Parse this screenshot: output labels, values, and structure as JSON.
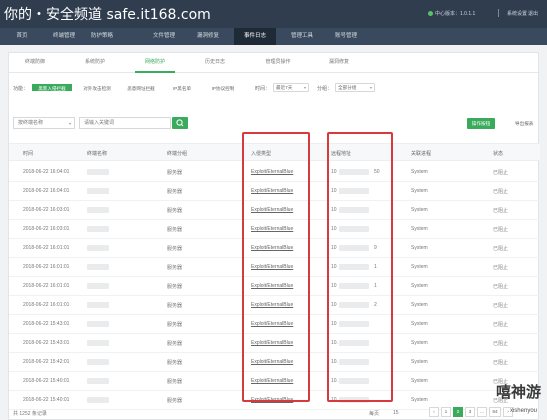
{
  "header": {
    "watermark_title": "你的・安全频道 safe.it168.com",
    "center_version": "中心版本：1.0.1.1",
    "links": [
      "系统设置",
      "退出"
    ]
  },
  "nav": {
    "items": [
      "首页",
      "终端管理",
      "防护策略",
      "文件管理",
      "漏洞修复",
      "事件日志",
      "管理工具",
      "账号管理"
    ],
    "active": "事件日志"
  },
  "subtabs": {
    "items": [
      "终端防御",
      "系统防护",
      "网络防护",
      "历史日志",
      "管理员操作",
      "漏洞修复"
    ],
    "active": "网络防护"
  },
  "filters": {
    "function_label": "功能：",
    "function_options": [
      "黑客入侵拦截",
      "对外攻击检测",
      "恶意网址拦截",
      "IP黑名单",
      "IP协议控制"
    ],
    "function_active": "黑客入侵拦截",
    "time_label": "时间：",
    "time_value": "最近7天",
    "group_label": "分组：",
    "group_value": "全部分组"
  },
  "search": {
    "select_value": "按终端名称",
    "placeholder": "请输入关键词",
    "settings_button": "操作按钮",
    "export_button": "导出报表"
  },
  "table": {
    "columns": [
      "时间",
      "终端名称",
      "终端分组",
      "入侵类型",
      "远程地址",
      "关联进程",
      "状态"
    ],
    "rows": [
      {
        "time": "2018-06-22 16:04:01",
        "group": "服务器",
        "type": "Exploit/EternalBlue",
        "addr": "10",
        "addr_tail": "50",
        "process": "System",
        "status": "已阻止"
      },
      {
        "time": "2018-06-22 16:04:01",
        "group": "服务器",
        "type": "Exploit/EternalBlue",
        "addr": "10",
        "addr_tail": "",
        "process": "System",
        "status": "已阻止"
      },
      {
        "time": "2018-06-22 16:03:01",
        "group": "服务器",
        "type": "Exploit/EternalBlue",
        "addr": "10",
        "addr_tail": "",
        "process": "System",
        "status": "已阻止"
      },
      {
        "time": "2018-06-22 16:03:01",
        "group": "服务器",
        "type": "Exploit/EternalBlue",
        "addr": "10",
        "addr_tail": "",
        "process": "System",
        "status": "已阻止"
      },
      {
        "time": "2018-06-22 16:01:01",
        "group": "服务器",
        "type": "Exploit/EternalBlue",
        "addr": "10",
        "addr_tail": "9",
        "process": "System",
        "status": "已阻止"
      },
      {
        "time": "2018-06-22 16:01:01",
        "group": "服务器",
        "type": "Exploit/EternalBlue",
        "addr": "10",
        "addr_tail": "1",
        "process": "System",
        "status": "已阻止"
      },
      {
        "time": "2018-06-22 16:01:01",
        "group": "服务器",
        "type": "Exploit/EternalBlue",
        "addr": "10",
        "addr_tail": "1",
        "process": "System",
        "status": "已阻止"
      },
      {
        "time": "2018-06-22 16:01:01",
        "group": "服务器",
        "type": "Exploit/EternalBlue",
        "addr": "10",
        "addr_tail": "2",
        "process": "System",
        "status": "已阻止"
      },
      {
        "time": "2018-06-22 15:43:01",
        "group": "服务器",
        "type": "Exploit/EternalBlue",
        "addr": "10",
        "addr_tail": "",
        "process": "System",
        "status": "已阻止"
      },
      {
        "time": "2018-06-22 15:43:01",
        "group": "服务器",
        "type": "Exploit/EternalBlue",
        "addr": "10.",
        "addr_tail": "",
        "process": "System",
        "status": "已阻止"
      },
      {
        "time": "2018-06-22 15:42:01",
        "group": "服务器",
        "type": "Exploit/EternalBlue",
        "addr": "10.",
        "addr_tail": "",
        "process": "System",
        "status": "已阻止"
      },
      {
        "time": "2018-06-22 15:40:01",
        "group": "服务器",
        "type": "Exploit/EternalBlue",
        "addr": "10.",
        "addr_tail": "",
        "process": "System",
        "status": "已阻止"
      },
      {
        "time": "2018-06-22 15:40:01",
        "group": "服务器",
        "type": "Exploit/EternalBlue",
        "addr": "10.",
        "addr_tail": "",
        "process": "System",
        "status": "已阻止"
      }
    ]
  },
  "footer": {
    "total": "共 1252 条记录",
    "per_page_label": "每页",
    "per_page": "15",
    "pages": [
      "‹",
      "1",
      "2",
      "3",
      "…",
      "84",
      "›"
    ],
    "active_page": "2"
  },
  "watermark": {
    "title": "嘻神游",
    "subtitle": "xishenyou"
  },
  "colors": {
    "accent": "#3aaa5c",
    "header_bg": "#2f3d4f",
    "highlight": "#d8393f"
  }
}
